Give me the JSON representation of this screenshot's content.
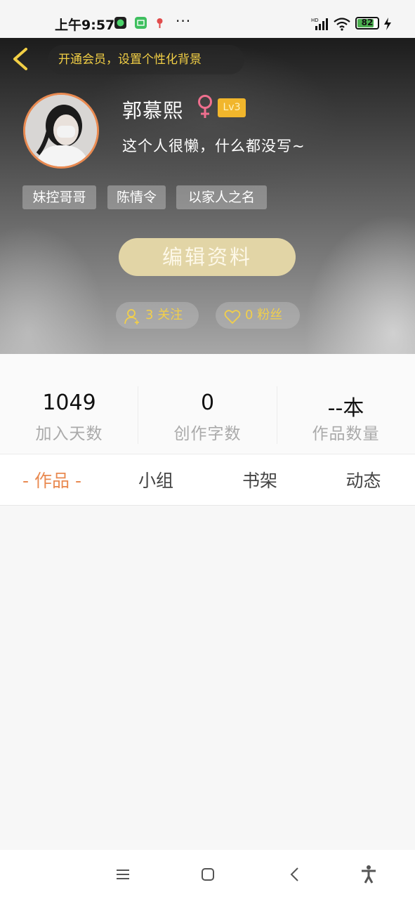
{
  "status_bar": {
    "time": "上午9:57",
    "more": "···",
    "battery": "82",
    "battery_level": 0.82
  },
  "header": {
    "vip_banner": "开通会员，设置个性化背景",
    "username": "郭慕熙",
    "gender": "female",
    "level": "Lv3",
    "bio": "这个人很懒，什么都没写~",
    "tags": [
      "妹控哥哥",
      "陈情令",
      "以家人之名"
    ],
    "edit_button": "编辑资料",
    "follow_count": "3",
    "follow_label": "关注",
    "fans_count": "0",
    "fans_label": "粉丝"
  },
  "stats": [
    {
      "value": "1049",
      "label": "加入天数"
    },
    {
      "value": "0",
      "label": "创作字数"
    },
    {
      "value": "--本",
      "label": "作品数量"
    }
  ],
  "tabs": [
    {
      "label": "- 作品 -",
      "active": true
    },
    {
      "label": "小组",
      "active": false
    },
    {
      "label": "书架",
      "active": false
    },
    {
      "label": "动态",
      "active": false
    }
  ],
  "colors": {
    "accent": "#e98a51",
    "gold": "#f1cf4b",
    "level_badge": "#f1b62c",
    "edit_button": "#e2d5a6"
  },
  "icons": {
    "back": "chevron-left-icon",
    "gender": "female-symbol-icon",
    "follow": "user-plus-icon",
    "fans": "heart-outline-icon",
    "nav": [
      "menu-icon",
      "home-square-icon",
      "back-chevron-icon",
      "accessibility-icon"
    ]
  }
}
